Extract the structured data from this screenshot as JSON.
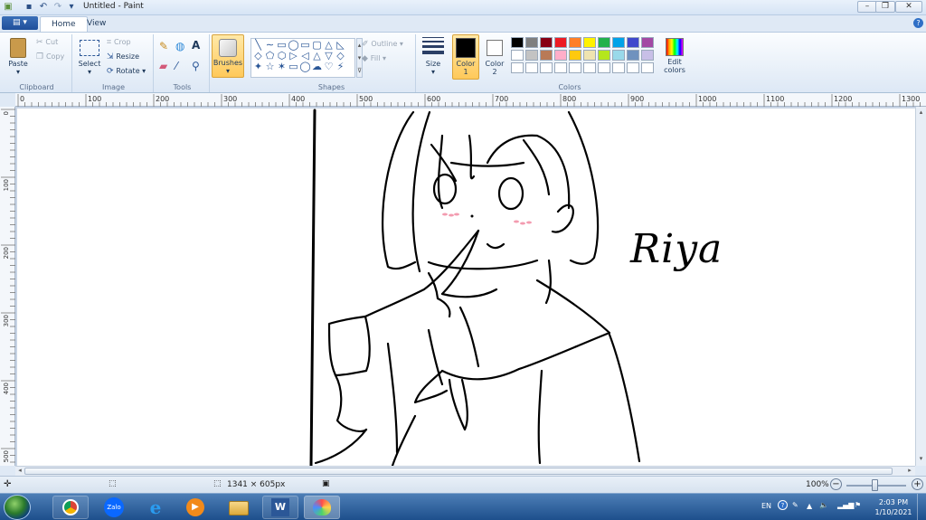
{
  "window": {
    "title": "Untitled - Paint"
  },
  "tabs": [
    {
      "label": "Home"
    },
    {
      "label": "View"
    }
  ],
  "clipboard": {
    "group": "Clipboard",
    "paste": "Paste",
    "cut": "Cut",
    "copy": "Copy"
  },
  "image": {
    "group": "Image",
    "select": "Select",
    "crop": "Crop",
    "resize": "Resize",
    "rotate": "Rotate"
  },
  "tools": {
    "group": "Tools"
  },
  "brushes": {
    "label": "Brushes"
  },
  "shapes": {
    "group": "Shapes",
    "outline": "Outline",
    "fill": "Fill"
  },
  "size": {
    "label": "Size"
  },
  "colors": {
    "group": "Colors",
    "color1": "Color 1",
    "color2": "Color 2",
    "edit": "Edit colors",
    "color1_value": "#000000",
    "color2_value": "#ffffff",
    "palette_row1": [
      "#000000",
      "#7f7f7f",
      "#880015",
      "#ed1c24",
      "#ff7f27",
      "#fff200",
      "#22b14c",
      "#00a2e8",
      "#3f48cc",
      "#a349a4"
    ],
    "palette_row2": [
      "#ffffff",
      "#c3c3c3",
      "#b97a57",
      "#ffaec9",
      "#ffc90e",
      "#efe4b0",
      "#b5e61d",
      "#99d9ea",
      "#7092be",
      "#c8bfe7"
    ]
  },
  "ruler": {
    "h": [
      "0",
      "100",
      "200",
      "300",
      "400",
      "500",
      "600",
      "700",
      "800",
      "900",
      "1000",
      "1100",
      "1200",
      "1300"
    ],
    "v": [
      "0",
      "100",
      "200",
      "300",
      "400",
      "500"
    ]
  },
  "drawing": {
    "signature": "Riya"
  },
  "status": {
    "dimensions": "1341 × 605px",
    "zoom": "100%"
  },
  "tray": {
    "lang": "EN",
    "time": "2:03 PM",
    "date": "1/10/2021"
  },
  "taskbar": {
    "zalo": "Zalo"
  }
}
